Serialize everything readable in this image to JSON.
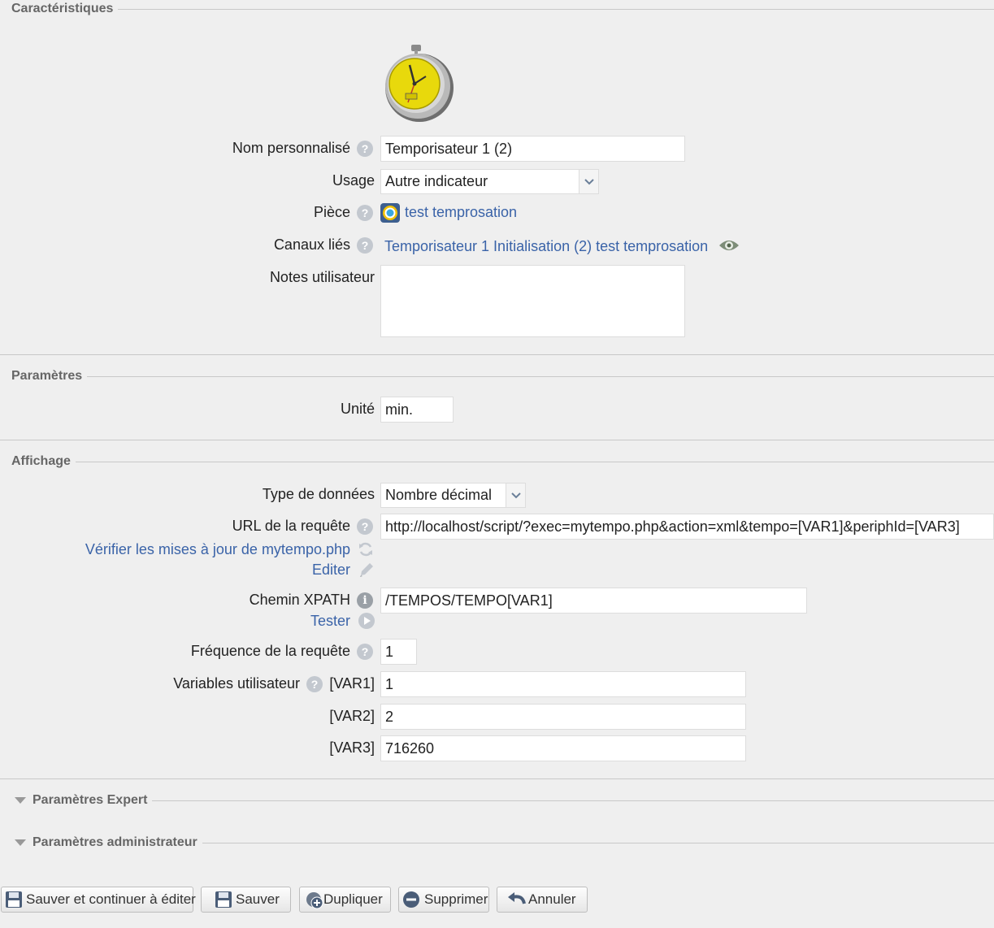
{
  "sections": {
    "caracteristiques": "Caractéristiques",
    "parametres": "Paramètres",
    "affichage": "Affichage",
    "expert": "Paramètres Expert",
    "admin": "Paramètres administrateur"
  },
  "caracteristiques": {
    "nom_label": "Nom personnalisé",
    "nom_value": "Temporisateur 1 (2)",
    "usage_label": "Usage",
    "usage_value": "Autre indicateur",
    "piece_label": "Pièce",
    "piece_link": "test temprosation",
    "canaux_label": "Canaux liés",
    "canaux_link": "Temporisateur 1 Initialisation (2) test temprosation",
    "notes_label": "Notes utilisateur",
    "notes_value": ""
  },
  "parametres": {
    "unite_label": "Unité",
    "unite_value": "min."
  },
  "affichage": {
    "type_label": "Type de données",
    "type_value": "Nombre décimal",
    "url_label": "URL de la requête",
    "url_value": "http://localhost/script/?exec=mytempo.php&action=xml&tempo=[VAR1]&periphId=[VAR3]",
    "verifier_link": "Vérifier les mises à jour de mytempo.php",
    "editer_link": "Editer",
    "xpath_label": "Chemin XPATH",
    "xpath_value": "/TEMPOS/TEMPO[VAR1]",
    "tester_link": "Tester",
    "freq_label": "Fréquence de la requête",
    "freq_value": "1",
    "vars_label": "Variables utilisateur",
    "var1_label": "[VAR1]",
    "var1_value": "1",
    "var2_label": "[VAR2]",
    "var2_value": "2",
    "var3_label": "[VAR3]",
    "var3_value": "716260"
  },
  "buttons": {
    "save_continue": "Sauver et continuer à éditer",
    "save": "Sauver",
    "duplicate": "Dupliquer",
    "delete": "Supprimer",
    "cancel": "Annuler"
  },
  "icons": {
    "device": "stopwatch-icon",
    "help": "help-icon",
    "room": "room-icon",
    "eye": "eye-icon",
    "refresh": "refresh-icon",
    "pencil": "pencil-icon",
    "info": "info-icon",
    "play": "play-icon",
    "save": "floppy-icon",
    "add": "add-icon",
    "remove": "remove-icon",
    "undo": "undo-icon"
  },
  "colors": {
    "link": "#3a63a8",
    "background": "#efefef",
    "legend": "#666666"
  }
}
